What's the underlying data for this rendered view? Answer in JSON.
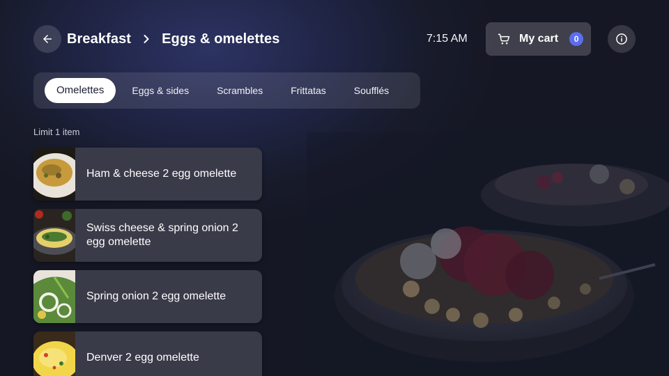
{
  "header": {
    "back_icon": "arrow-left-icon",
    "breadcrumb": {
      "parent": "Breakfast",
      "separator_icon": "chevron-right-icon",
      "current": "Eggs & omelettes"
    },
    "time": "7:15 AM",
    "cart": {
      "icon": "shopping-cart-icon",
      "label": "My cart",
      "count": "0",
      "badge_color": "#5b6df0"
    },
    "info_icon": "info-icon"
  },
  "tabs": [
    {
      "label": "Omelettes",
      "active": true
    },
    {
      "label": "Eggs & sides",
      "active": false
    },
    {
      "label": "Scrambles",
      "active": false
    },
    {
      "label": "Frittatas",
      "active": false
    },
    {
      "label": "Soufflés",
      "active": false
    }
  ],
  "limit_text": "Limit 1 item",
  "items": [
    {
      "label": "Ham & cheese 2 egg omelette"
    },
    {
      "label": "Swiss cheese & spring onion 2 egg omelette"
    },
    {
      "label": "Spring onion 2 egg omelette"
    },
    {
      "label": "Denver 2 egg omelette"
    }
  ]
}
